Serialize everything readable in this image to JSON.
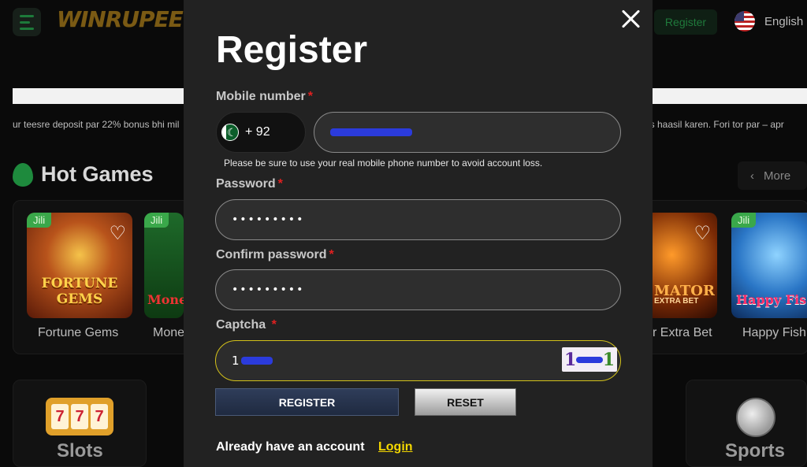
{
  "header": {
    "logo": "WINRUPEE",
    "register_label": "Register",
    "language": "English"
  },
  "marquee": {
    "left_text": "ur teesre deposit par 22% bonus bhi mil",
    "right_text": "us haasil karen. Fori tor par – apr"
  },
  "hot_games": {
    "title": "Hot Games",
    "more_label": "More",
    "games": [
      {
        "tag": "Jili",
        "art": "FORTUNE GEMS",
        "name": "Fortune Gems"
      },
      {
        "tag": "Jili",
        "art": "Mone",
        "name": "Mone"
      },
      {
        "tag": "",
        "art": "MATOR",
        "art_sub": "EXTRA BET",
        "name": "r Extra Bet"
      },
      {
        "tag": "Jili",
        "art": "Happy Fis",
        "name": "Happy Fish"
      }
    ]
  },
  "categories": {
    "slots_label": "Slots",
    "sports_label": "Sports",
    "slot_reels": [
      "7",
      "7",
      "7"
    ]
  },
  "modal": {
    "title": "Register",
    "mobile_label": "Mobile number",
    "country_code": "+ 92",
    "mobile_hint": "Please be sure to use your real mobile phone number to avoid account loss.",
    "password_label": "Password",
    "password_value": "•••••••••",
    "confirm_label": "Confirm password",
    "confirm_value": "•••••••••",
    "captcha_label": "Captcha",
    "captcha_input_prefix": "1",
    "captcha_image_left": "1",
    "captcha_image_right": "1",
    "required_mark": "*",
    "register_button": "REGISTER",
    "reset_button": "RESET",
    "already_text": "Already have an account",
    "login_link": "Login"
  },
  "icons": {
    "close": "close-icon",
    "menu": "menu-icon",
    "flag_pakistan": "pakistan-flag-icon",
    "flag_us": "us-flag-icon",
    "fire": "fire-icon",
    "heart": "heart-icon",
    "chevron_left": "chevron-left-icon"
  },
  "colors": {
    "modal_bg": "#222222",
    "required": "#e02020",
    "login_link": "#f5d800",
    "captcha_focus": "#d4c21a"
  }
}
